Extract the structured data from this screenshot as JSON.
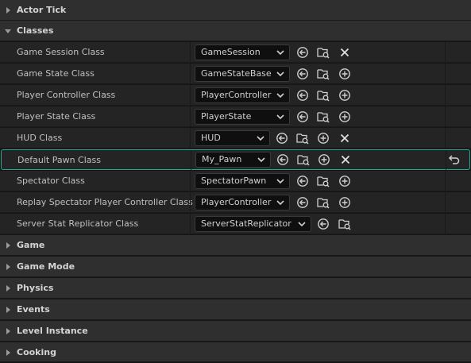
{
  "categories": {
    "actor_tick": "Actor Tick",
    "classes": "Classes",
    "game": "Game",
    "game_mode": "Game Mode",
    "physics": "Physics",
    "events": "Events",
    "level_instance": "Level Instance",
    "cooking": "Cooking"
  },
  "rows": [
    {
      "label": "Game Session Class",
      "value": "GameSession",
      "icons": [
        "use-selected-icon",
        "browse-icon",
        "clear-icon"
      ]
    },
    {
      "label": "Game State Class",
      "value": "GameStateBase",
      "icons": [
        "use-selected-icon",
        "browse-icon",
        "add-icon"
      ]
    },
    {
      "label": "Player Controller Class",
      "value": "PlayerController",
      "icons": [
        "use-selected-icon",
        "browse-icon",
        "add-icon"
      ]
    },
    {
      "label": "Player State Class",
      "value": "PlayerState",
      "icons": [
        "use-selected-icon",
        "browse-icon",
        "add-icon"
      ]
    },
    {
      "label": "HUD Class",
      "value": "HUD",
      "icons": [
        "use-selected-icon",
        "browse-icon",
        "add-icon",
        "clear-icon"
      ]
    },
    {
      "label": "Default Pawn Class",
      "value": "My_Pawn",
      "icons": [
        "use-selected-icon",
        "browse-icon",
        "add-icon",
        "clear-icon"
      ],
      "selected": true
    },
    {
      "label": "Spectator Class",
      "value": "SpectatorPawn",
      "icons": [
        "use-selected-icon",
        "browse-icon",
        "add-icon"
      ]
    },
    {
      "label": "Replay Spectator Player Controller Class",
      "value": "PlayerController",
      "icons": [
        "use-selected-icon",
        "browse-icon",
        "add-icon"
      ]
    },
    {
      "label": "Server Stat Replicator Class",
      "value": "ServerStatReplicator",
      "icons": [
        "use-selected-icon",
        "browse-icon"
      ]
    }
  ],
  "colors": {
    "accent": "#2aa58e",
    "panel": "#242424",
    "header": "#2f2f2f"
  }
}
